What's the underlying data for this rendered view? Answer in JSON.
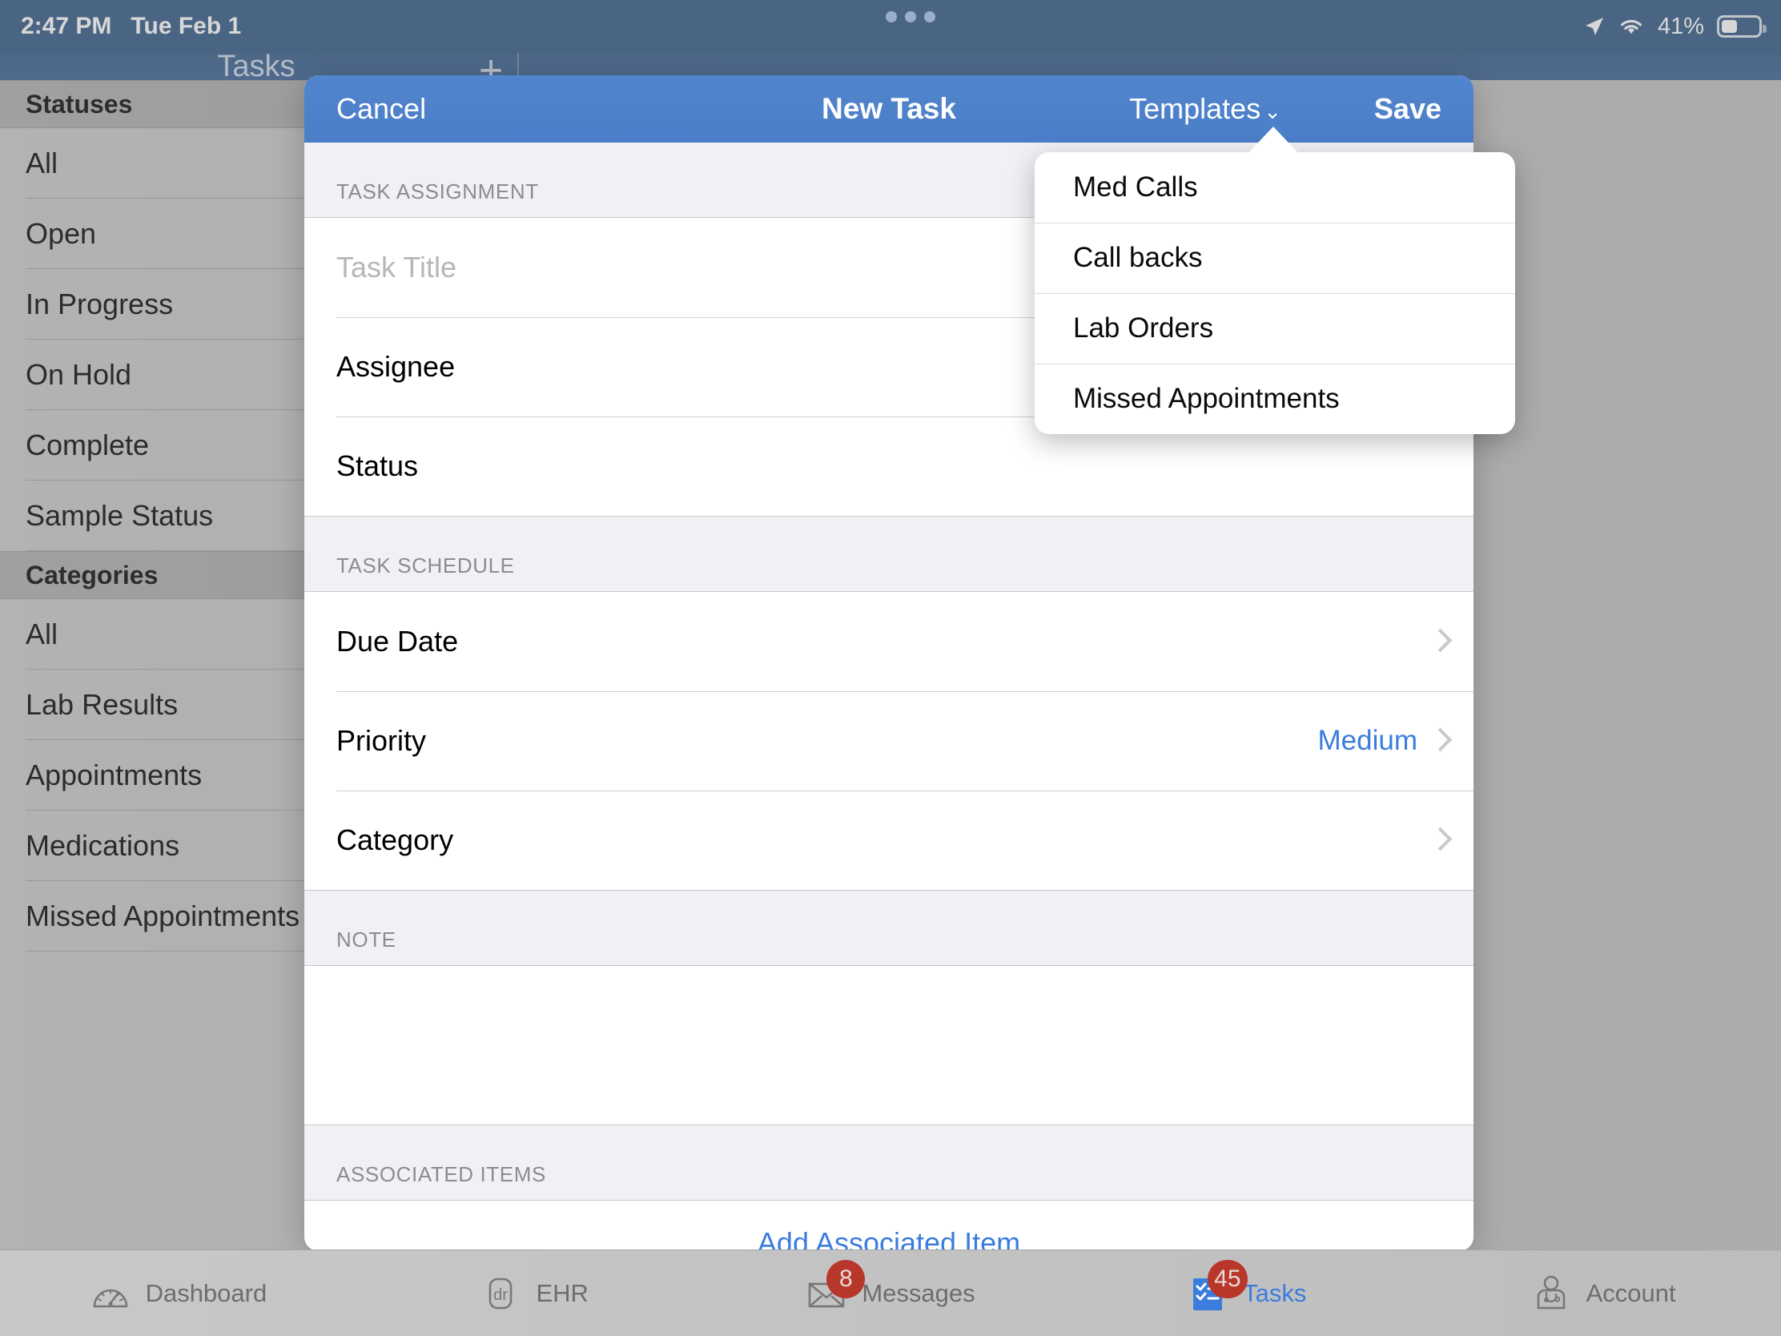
{
  "status_bar": {
    "time": "2:47 PM",
    "date": "Tue Feb 1",
    "battery_percent": "41%",
    "icons": [
      "location-arrow-icon",
      "wifi-icon",
      "battery-icon"
    ]
  },
  "nav": {
    "title": "Tasks",
    "add_button": "+"
  },
  "sidebar": {
    "sections": [
      {
        "header": "Statuses",
        "items": [
          "All",
          "Open",
          "In Progress",
          "On Hold",
          "Complete",
          "Sample Status"
        ]
      },
      {
        "header": "Categories",
        "items": [
          "All",
          "Lab Results",
          "Appointments",
          "Medications",
          "Missed Appointments"
        ]
      }
    ]
  },
  "modal": {
    "header": {
      "cancel": "Cancel",
      "title": "New Task",
      "templates": "Templates",
      "templates_chevron": "⌄",
      "save": "Save"
    },
    "sections": {
      "task_assignment": {
        "label": "TASK ASSIGNMENT",
        "rows": [
          {
            "label": "",
            "placeholder": "Task Title",
            "type": "input",
            "value": ""
          },
          {
            "label": "Assignee",
            "value": "",
            "type": "plain"
          },
          {
            "label": "Status",
            "value": "",
            "type": "plain"
          }
        ]
      },
      "task_schedule": {
        "label": "TASK SCHEDULE",
        "rows": [
          {
            "label": "Due Date",
            "value": "",
            "type": "disclosure"
          },
          {
            "label": "Priority",
            "value": "Medium",
            "type": "disclosure"
          },
          {
            "label": "Category",
            "value": "",
            "type": "disclosure"
          }
        ]
      },
      "note": {
        "label": "NOTE",
        "value": ""
      },
      "associated_items": {
        "label": "ASSOCIATED ITEMS",
        "add_label": "Add Associated Item"
      }
    }
  },
  "templates_dropdown": {
    "open": true,
    "items": [
      "Med Calls",
      "Call backs",
      "Lab Orders",
      "Missed Appointments"
    ]
  },
  "tabbar": {
    "tabs": [
      {
        "label": "Dashboard",
        "icon": "gauge-icon",
        "badge": "",
        "active": false
      },
      {
        "label": "EHR",
        "icon": "dr-icon",
        "badge": "",
        "active": false
      },
      {
        "label": "Messages",
        "icon": "envelope-icon",
        "badge": "8",
        "active": false
      },
      {
        "label": "Tasks",
        "icon": "checklist-icon",
        "badge": "45",
        "active": true
      },
      {
        "label": "Account",
        "icon": "doctor-icon",
        "badge": "",
        "active": false
      }
    ]
  },
  "colors": {
    "status_bar_blue": "#375d8a",
    "modal_header_blue": "#4d80ca",
    "accent_blue": "#3b7ddd",
    "badge_red": "#b9362a",
    "sidebar_grey": "#c9c9c9"
  }
}
